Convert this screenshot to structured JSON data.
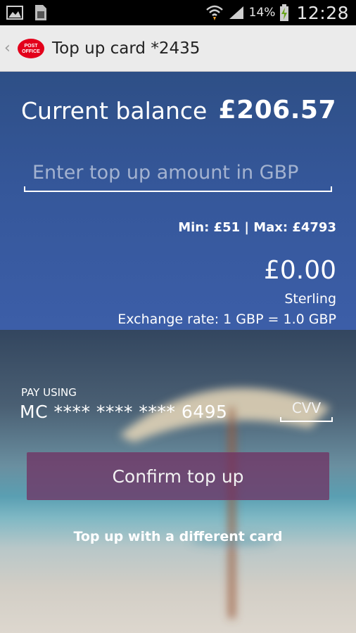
{
  "status_bar": {
    "left_icons": [
      "gallery-icon",
      "sim-card-icon"
    ],
    "battery_percent": "14%",
    "time": "12:28"
  },
  "action_bar": {
    "logo_text": "POST OFFICE",
    "title": "Top up card *2435"
  },
  "balance": {
    "label": "Current balance",
    "value": "£206.57"
  },
  "amount_input": {
    "placeholder": "Enter top up amount in GBP",
    "value": ""
  },
  "limits": "Min: £51 | Max: £4793",
  "conversion": {
    "amount": "£0.00",
    "currency": "Sterling",
    "exchange_rate": "Exchange rate: 1 GBP = 1.0 GBP"
  },
  "payment": {
    "pay_using_label": "PAY USING",
    "card": "MC **** **** **** 6495",
    "cvv_placeholder": "CVV"
  },
  "actions": {
    "confirm_label": "Confirm top up",
    "different_card_label": "Top up with a different card"
  },
  "colors": {
    "top_panel": "#35579a",
    "confirm_button": "#702c60",
    "logo_red": "#e3001b"
  }
}
